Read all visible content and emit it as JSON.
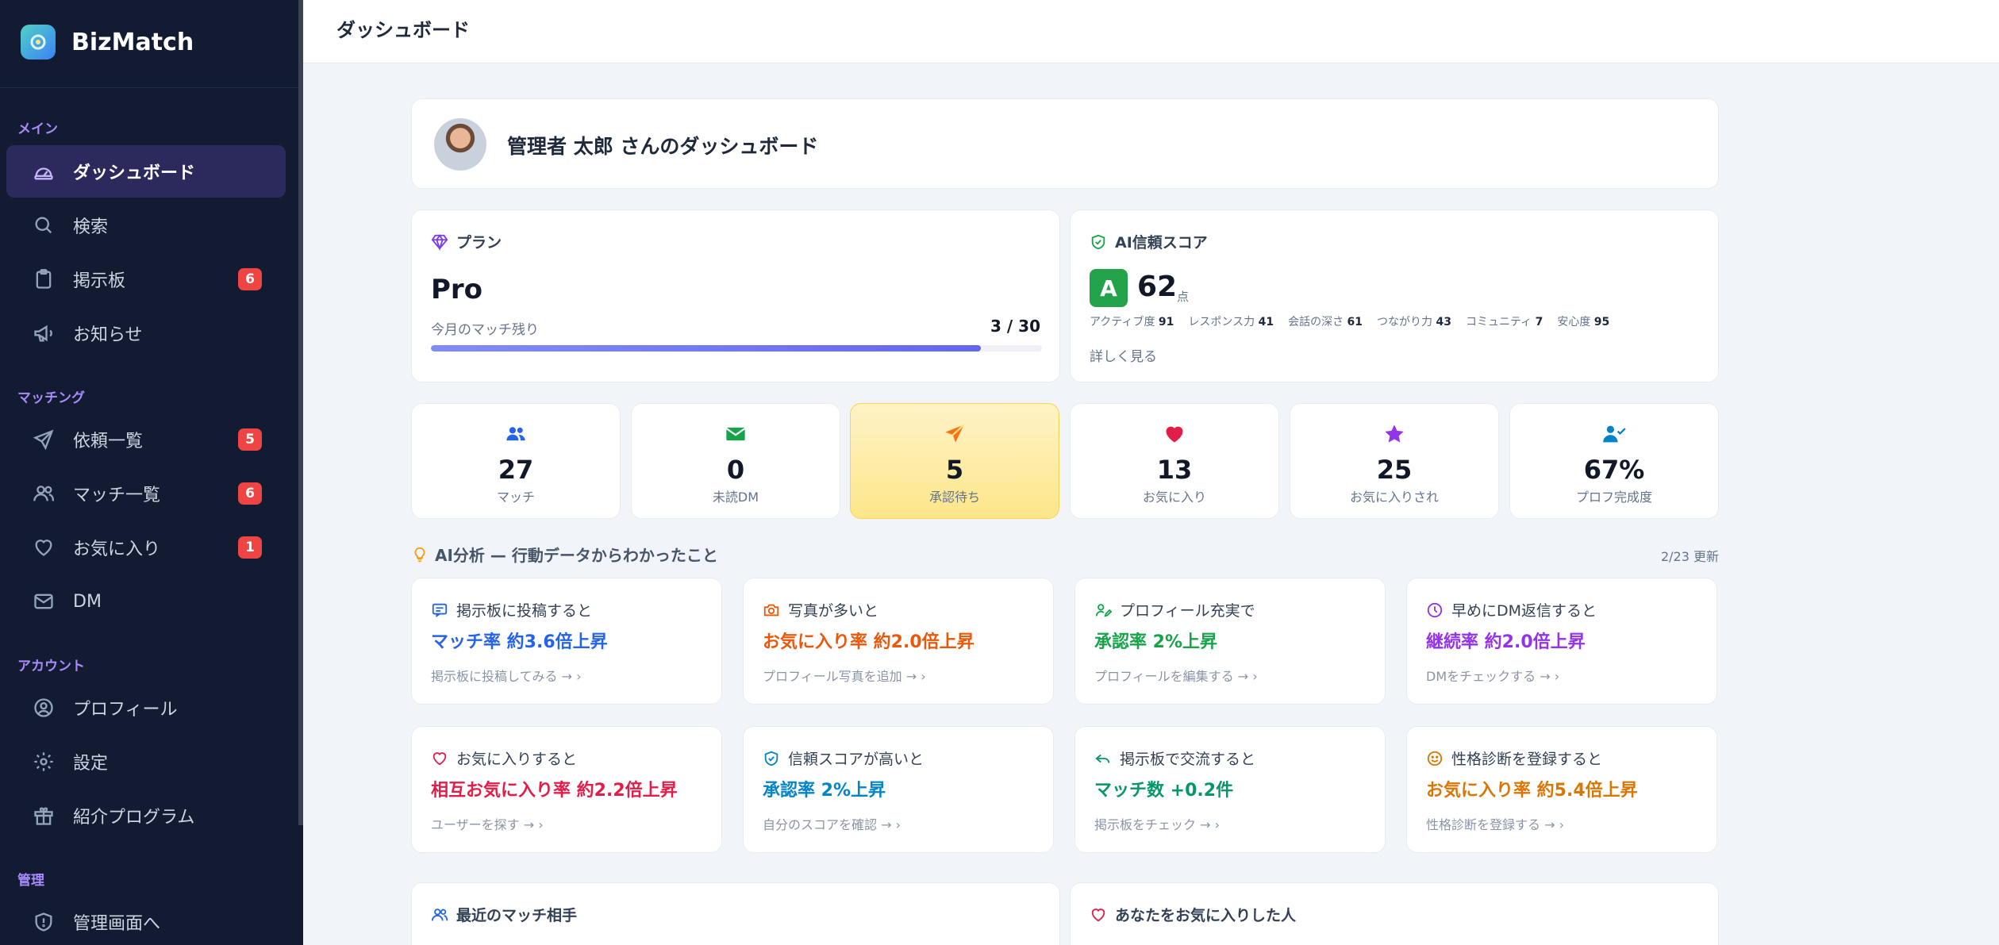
{
  "app": {
    "name": "BizMatch"
  },
  "sidebar": {
    "sections": {
      "main": "メイン",
      "matching": "マッチング",
      "account": "アカウント",
      "admin": "管理"
    },
    "items": {
      "dashboard": {
        "label": "ダッシュボード",
        "icon": "dashboard-icon"
      },
      "search": {
        "label": "検索",
        "icon": "search-icon"
      },
      "board": {
        "label": "掲示板",
        "badge": "6",
        "icon": "clipboard-icon"
      },
      "news": {
        "label": "お知らせ",
        "icon": "megaphone-icon"
      },
      "requests": {
        "label": "依頼一覧",
        "badge": "5",
        "icon": "send-icon"
      },
      "matches": {
        "label": "マッチ一覧",
        "badge": "6",
        "icon": "users-icon"
      },
      "favorites": {
        "label": "お気に入り",
        "badge": "1",
        "icon": "heart-icon"
      },
      "dm": {
        "label": "DM",
        "icon": "mail-icon"
      },
      "profile": {
        "label": "プロフィール",
        "icon": "user-circle-icon"
      },
      "settings": {
        "label": "設定",
        "icon": "gear-icon"
      },
      "referral": {
        "label": "紹介プログラム",
        "icon": "gift-icon"
      },
      "admin": {
        "label": "管理画面へ",
        "icon": "shield-icon"
      }
    }
  },
  "header": {
    "title": "ダッシュボード"
  },
  "welcome": {
    "text": "管理者 太郎 さんのダッシュボード"
  },
  "plan": {
    "heading": "プラン",
    "name": "Pro",
    "remain_label": "今月のマッチ残り",
    "remain_value": "3 / 30",
    "progress": 0.9
  },
  "trust": {
    "heading": "AI信頼スコア",
    "grade": "A",
    "score": "62",
    "unit": "点",
    "metrics": [
      {
        "label": "アクティブ度",
        "value": "91"
      },
      {
        "label": "レスポンス力",
        "value": "41"
      },
      {
        "label": "会話の深さ",
        "value": "61"
      },
      {
        "label": "つながり力",
        "value": "43"
      },
      {
        "label": "コミュニティ",
        "value": "7"
      },
      {
        "label": "安心度",
        "value": "95"
      }
    ],
    "more": "詳しく見る"
  },
  "stats": [
    {
      "value": "27",
      "label": "マッチ",
      "color": "#2563eb"
    },
    {
      "value": "0",
      "label": "未読DM",
      "color": "#16a34a"
    },
    {
      "value": "5",
      "label": "承認待ち",
      "color": "#f97316"
    },
    {
      "value": "13",
      "label": "お気に入り",
      "color": "#e11d48"
    },
    {
      "value": "25",
      "label": "お気に入りされ",
      "color": "#9333ea"
    },
    {
      "value": "67%",
      "label": "プロフ完成度",
      "color": "#0284c7"
    }
  ],
  "ai": {
    "heading": "AI分析 — 行動データからわかったこと",
    "updated": "2/23 更新",
    "insights": [
      {
        "title": "掲示板に投稿すると",
        "result": "マッチ率 約3.6倍上昇",
        "link": "掲示板に投稿してみる → ›",
        "color": "#2563eb"
      },
      {
        "title": "写真が多いと",
        "result": "お気に入り率 約2.0倍上昇",
        "link": "プロフィール写真を追加 → ›",
        "color": "#ea580c"
      },
      {
        "title": "プロフィール充実で",
        "result": "承認率 2%上昇",
        "link": "プロフィールを編集する → ›",
        "color": "#16a34a"
      },
      {
        "title": "早めにDM返信すると",
        "result": "継続率 約2.0倍上昇",
        "link": "DMをチェックする → ›",
        "color": "#9333ea"
      },
      {
        "title": "お気に入りすると",
        "result": "相互お気に入り率 約2.2倍上昇",
        "link": "ユーザーを探す → ›",
        "color": "#e11d48"
      },
      {
        "title": "信頼スコアが高いと",
        "result": "承認率 2%上昇",
        "link": "自分のスコアを確認 → ›",
        "color": "#0284c7"
      },
      {
        "title": "掲示板で交流すると",
        "result": "マッチ数 +0.2件",
        "link": "掲示板をチェック → ›",
        "color": "#059669"
      },
      {
        "title": "性格診断を登録すると",
        "result": "お気に入り率 約5.4倍上昇",
        "link": "性格診断を登録する → ›",
        "color": "#d97706"
      }
    ]
  },
  "bottom": {
    "recent_matches": "最近のマッチ相手",
    "favorited_by": "あなたをお気に入りした人"
  }
}
